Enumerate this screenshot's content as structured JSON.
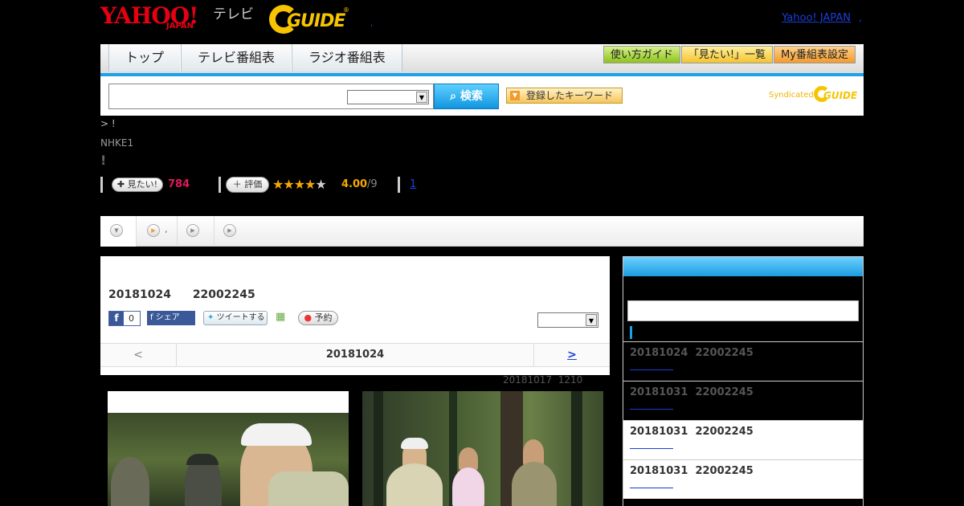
{
  "header": {
    "logo_yahoo": "YAHOO!",
    "logo_yahoo_sub": "JAPAN",
    "logo_tv": "テレビ",
    "logo_gguide": "GUIDE",
    "logo_gguide_reg": "®",
    "dot": ",",
    "yahoo_link": "Yahoo! JAPAN",
    "yahoo_link_dot": ","
  },
  "nav": {
    "tabs": [
      {
        "label": "トップ"
      },
      {
        "label": "テレビ番組表"
      },
      {
        "label": "ラジオ番組表"
      }
    ],
    "buttons": [
      {
        "label": "使い方ガイド"
      },
      {
        "label": "「見たい!」一覧"
      },
      {
        "label": "My番組表設定"
      }
    ]
  },
  "search": {
    "input_value": "",
    "select_value": "",
    "button_label": "検索",
    "button_icon": "search-icon",
    "keyword_button_label": "登録したキーワード",
    "syndicated": "Syndicated",
    "syndicated_logo": "GUIDE"
  },
  "program": {
    "breadcrumb": "> !",
    "channel": "NHKE1",
    "mark": "!",
    "want_label": "見たい!",
    "want_count": "784",
    "rate_label": "評価",
    "rating_stars": 4,
    "rating_max": 5,
    "rating_value": "4.00",
    "rating_count": "/9",
    "reply_link": "1"
  },
  "detail": {
    "date": "20181024",
    "time": "22002245",
    "fb_count": "0",
    "fb_share": "シェア",
    "tweet": "ツイートする",
    "reserve": "予約",
    "select_value": "",
    "day_prev": "<",
    "day_current": "20181024",
    "day_next": ">",
    "updated_date": "20181017",
    "updated_time": "1210"
  },
  "subnav": {
    "item2_label": ","
  },
  "sidebar": {
    "input_value": "",
    "items": [
      {
        "date": "20181024",
        "time": "22002245"
      },
      {
        "date": "20181031",
        "time": "22002245"
      },
      {
        "date": "20181031",
        "time": "22002245"
      },
      {
        "date": "20181031",
        "time": "22002245"
      }
    ]
  },
  "colors": {
    "accent": "#1aa3e8",
    "want_count": "#e3185b",
    "star": "#f5a800",
    "link": "#1a3fd6"
  }
}
